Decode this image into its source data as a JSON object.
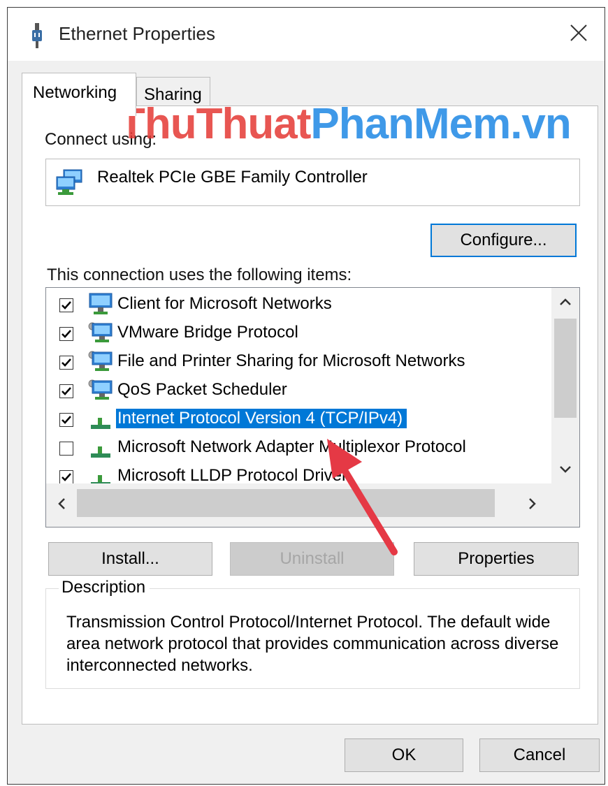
{
  "window": {
    "title": "Ethernet Properties",
    "close_symbol": "✕"
  },
  "tabs": [
    {
      "label": "Networking",
      "active": true
    },
    {
      "label": "Sharing",
      "active": false
    }
  ],
  "connect_using": {
    "label": "Connect using:",
    "adapter_name": "Realtek PCIe GBE Family Controller"
  },
  "configure_button": "Configure...",
  "items_label": "This connection uses the following items:",
  "items": [
    {
      "label": "Client for Microsoft Networks",
      "checked": true,
      "icon": "network-client-icon"
    },
    {
      "label": "VMware Bridge Protocol",
      "checked": true,
      "icon": "network-service-icon"
    },
    {
      "label": "File and Printer Sharing for Microsoft Networks",
      "checked": true,
      "icon": "network-service-icon"
    },
    {
      "label": "QoS Packet Scheduler",
      "checked": true,
      "icon": "network-service-icon"
    },
    {
      "label": "Internet Protocol Version 4 (TCP/IPv4)",
      "checked": true,
      "icon": "protocol-icon",
      "selected": true
    },
    {
      "label": "Microsoft Network Adapter Multiplexor Protocol",
      "checked": false,
      "icon": "protocol-icon"
    },
    {
      "label": "Microsoft LLDP Protocol Driver",
      "checked": true,
      "icon": "protocol-icon"
    }
  ],
  "buttons": {
    "install": "Install...",
    "uninstall": "Uninstall",
    "properties": "Properties"
  },
  "description": {
    "title": "Description",
    "text": "Transmission Control Protocol/Internet Protocol. The default wide area network protocol that provides communication across diverse interconnected networks."
  },
  "footer": {
    "ok": "OK",
    "cancel": "Cancel"
  },
  "watermark": {
    "part1": "ThuThuat",
    "part2": "PhanMem.vn"
  },
  "colors": {
    "selection": "#0078d7",
    "focus_border": "#0078d7",
    "annotation_arrow": "#e53945"
  }
}
